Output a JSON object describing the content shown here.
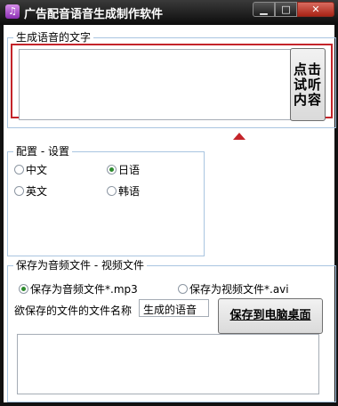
{
  "window": {
    "title": "广告配音语音生成制作软件",
    "app_icon": "music-note-icon",
    "minimize": "minimize-icon",
    "maximize": "maximize-icon",
    "close": "close-icon"
  },
  "text_group": {
    "legend": "生成语音的文字",
    "text_value": "",
    "listen_button_line1": "点击",
    "listen_button_line2": "试听",
    "listen_button_line3": "内容"
  },
  "config_group": {
    "legend": "配置 - 设置",
    "options": [
      {
        "label": "中文",
        "selected": false
      },
      {
        "label": "日语",
        "selected": true
      },
      {
        "label": "英文",
        "selected": false
      },
      {
        "label": "韩语",
        "selected": false
      }
    ]
  },
  "save_group": {
    "legend": "保存为音频文件 - 视频文件",
    "audio_option": {
      "label": "保存为音频文件*.mp3",
      "selected": true
    },
    "video_option": {
      "label": "保存为视频文件*.avi",
      "selected": false
    },
    "filename_label": "欲保存的文件的文件名称",
    "filename_value": "生成的语音",
    "save_button": "保存到电脑桌面",
    "log_value": ""
  },
  "colors": {
    "highlight_frame": "#c4242a",
    "group_border": "#a9c5e0",
    "selected_radio": "#2e8b2e"
  }
}
